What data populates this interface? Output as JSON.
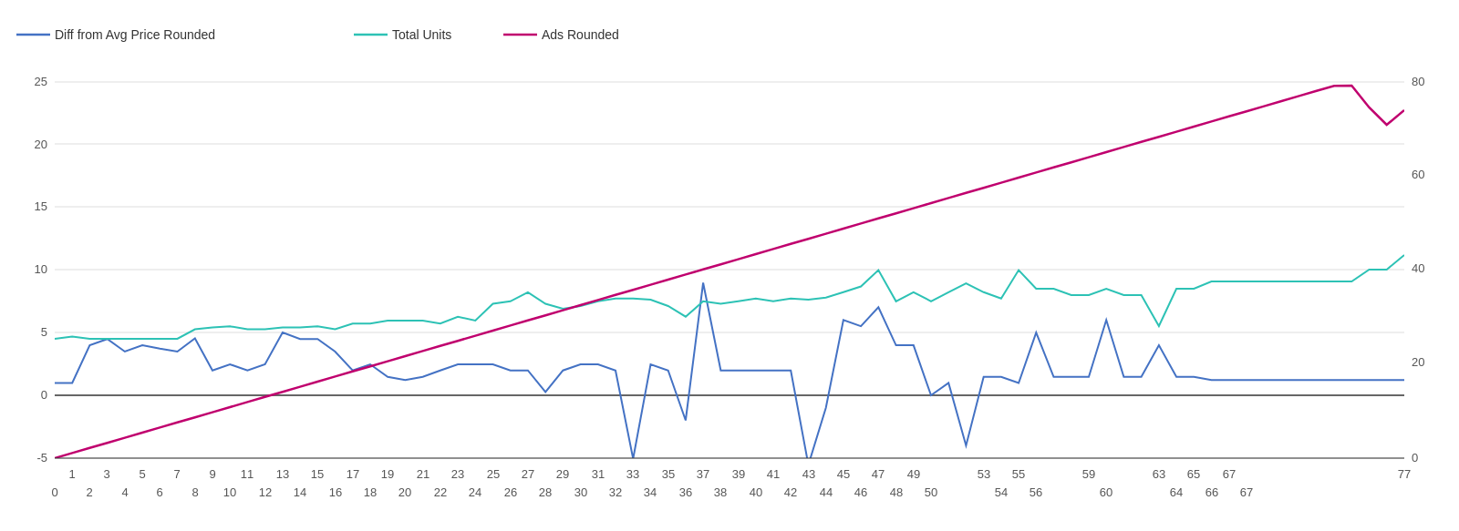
{
  "chart": {
    "title": "",
    "legend": [
      {
        "label": "Diff from Avg Price Rounded",
        "color": "#4472C4",
        "lineStyle": "solid"
      },
      {
        "label": "Total Units",
        "color": "#2DC2B5",
        "lineStyle": "solid"
      },
      {
        "label": "Ads Rounded",
        "color": "#C0006E",
        "lineStyle": "solid"
      }
    ],
    "leftAxis": {
      "min": -5,
      "max": 25,
      "ticks": [
        -5,
        0,
        5,
        10,
        15,
        20,
        25
      ]
    },
    "rightAxis": {
      "min": 0,
      "max": 80,
      "ticks": [
        0,
        20,
        40,
        60,
        80
      ]
    },
    "xAxis": {
      "topLabels": [
        1,
        3,
        5,
        7,
        9,
        11,
        13,
        15,
        17,
        19,
        21,
        23,
        25,
        27,
        29,
        31,
        33,
        35,
        37,
        39,
        41,
        43,
        45,
        47,
        49,
        53,
        55,
        59,
        63,
        65,
        67,
        77
      ],
      "bottomLabels": [
        0,
        2,
        4,
        6,
        8,
        10,
        12,
        14,
        16,
        18,
        20,
        22,
        24,
        26,
        28,
        30,
        32,
        34,
        36,
        38,
        40,
        42,
        44,
        46,
        48,
        50,
        54,
        56,
        60,
        64,
        66,
        67
      ]
    }
  }
}
